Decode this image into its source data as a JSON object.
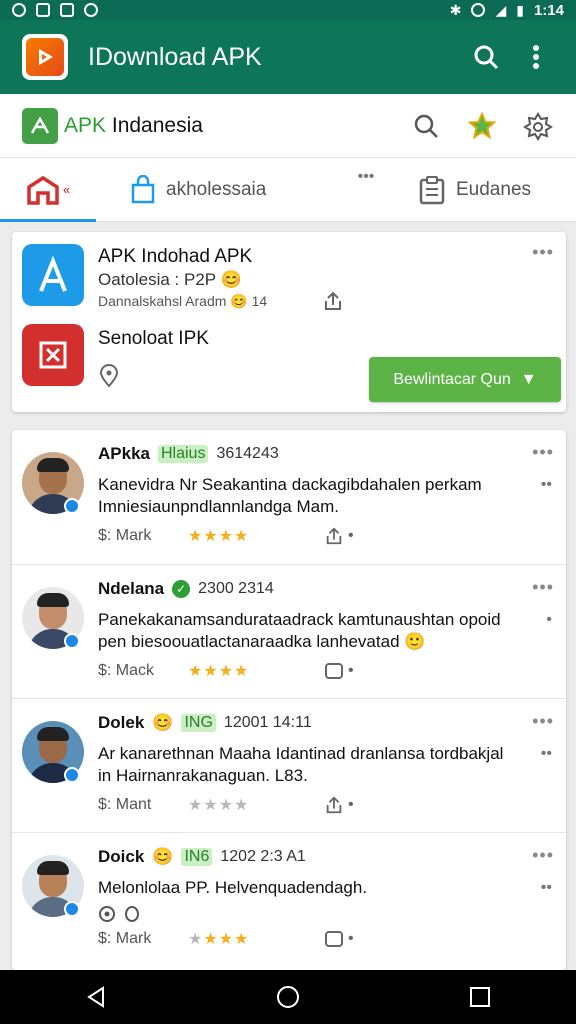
{
  "status_bar": {
    "time": "1:14"
  },
  "app_bar": {
    "title": "IDownload APK"
  },
  "sub_header": {
    "title_green": "APK",
    "title_rest": " Indanesia"
  },
  "tabs": [
    {
      "label": "«"
    },
    {
      "label": "akholessaia"
    },
    {
      "label": "•••"
    },
    {
      "label": "Eudanes"
    }
  ],
  "featured": {
    "app1": {
      "name": "APK Indohad APK",
      "subtitle": "Oatolesia : P2P",
      "meta": "Dannalskahsl Aradm",
      "rating": "14"
    },
    "app2": {
      "name": "Senoloat IPK"
    },
    "download_label": "Bewlintacar Qun"
  },
  "posts": [
    {
      "name": "APkka",
      "tag": "Hlaius",
      "date": "3614243",
      "text": "Kanevidra Nr Seakantina dackagibdahalen perkam Imniesiaunpndlannlandga Mam.",
      "mark": "$:  Mark",
      "stars": 4,
      "side": "••"
    },
    {
      "name": "Ndelana",
      "tag": "",
      "date": "2300  2314",
      "text": "Panekakanamsandurataadrack kamtunaushtan opoid pen biesoouatlactanaraadka lanhevatad",
      "mark": "$:  Mack",
      "stars": 4,
      "side": "•"
    },
    {
      "name": "Dolek",
      "tag": "ING",
      "date": "12001  14:11",
      "text": "Ar kanarethnan Maaha Idantinad dranlansa tordbakjal in Hairnanrakanaguan. L83.",
      "mark": "$:  Mant",
      "stars": 0,
      "side": "••"
    },
    {
      "name": "Doick",
      "tag": "IN6",
      "date": "1202  2:3 A1",
      "text": "Melonlolaa PP. Helvenquadendagh.",
      "mark": "$:  Mark",
      "stars": 3,
      "side": "••"
    }
  ]
}
